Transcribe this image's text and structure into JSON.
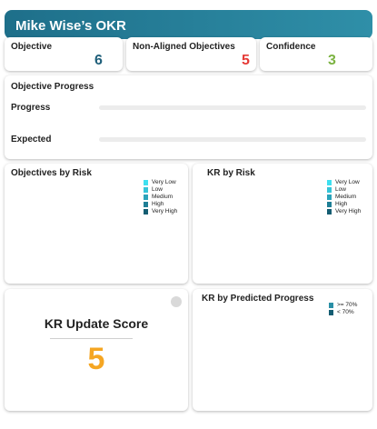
{
  "header": {
    "title": "Mike Wise’s OKR"
  },
  "kpis": {
    "objective": {
      "label": "Objective",
      "value": "6",
      "color": "#1f5f7a"
    },
    "non_aligned": {
      "label": "Non-Aligned Objectives",
      "value": "5",
      "color": "#e53935"
    },
    "confidence": {
      "label": "Confidence",
      "value": "3",
      "color": "#7cb342"
    }
  },
  "objective_progress": {
    "title": "Objective Progress",
    "rows": [
      {
        "label": "Progress",
        "value_fraction": 0
      },
      {
        "label": "Expected",
        "value_fraction": 0
      }
    ]
  },
  "objectives_by_risk": {
    "title": "Objectives by Risk",
    "legend": [
      {
        "label": "Very Low",
        "color": "#3ee0f0"
      },
      {
        "label": "Low",
        "color": "#35c4d8"
      },
      {
        "label": "Medium",
        "color": "#2aa3ba"
      },
      {
        "label": "High",
        "color": "#1f7f96"
      },
      {
        "label": "Very High",
        "color": "#145d72"
      }
    ]
  },
  "kr_by_risk": {
    "title": "KR by Risk",
    "legend": [
      {
        "label": "Very Low",
        "color": "#3ee0f0"
      },
      {
        "label": "Low",
        "color": "#35c4d8"
      },
      {
        "label": "Medium",
        "color": "#2aa3ba"
      },
      {
        "label": "High",
        "color": "#1f7f96"
      },
      {
        "label": "Very High",
        "color": "#145d72"
      }
    ]
  },
  "kr_update_score": {
    "label": "KR Update Score",
    "value": "5",
    "color": "#f5a623",
    "icon": "toggle-icon"
  },
  "kr_by_predicted_progress": {
    "title": "KR by Predicted Progress",
    "legend": [
      {
        "label": ">= 70%",
        "color": "#2a8fa6"
      },
      {
        "label": "< 70%",
        "color": "#145d72"
      }
    ]
  }
}
